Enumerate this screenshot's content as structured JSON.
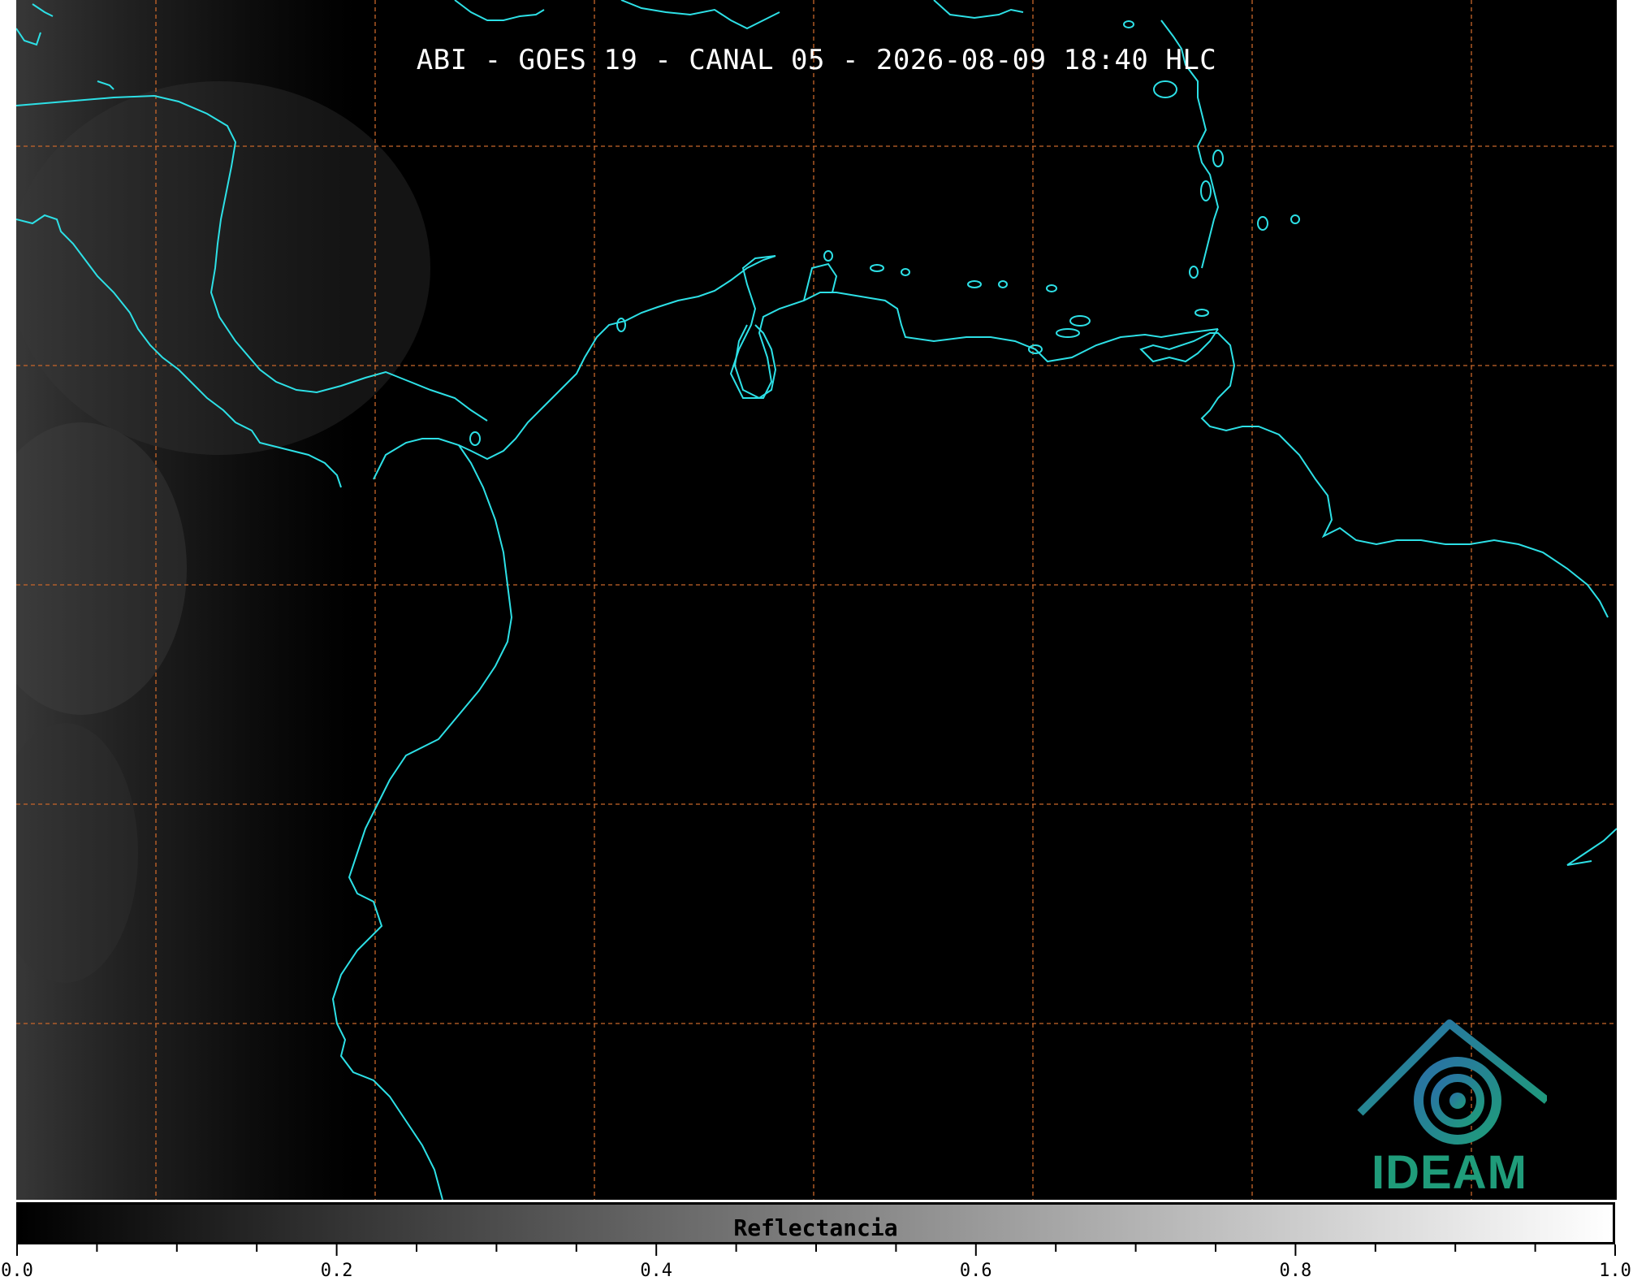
{
  "title": "ABI - GOES 19 - CANAL 05 - 2026-08-09 18:40 HLC",
  "colorbar": {
    "label": "Reflectancia",
    "ticks": [
      "0.0",
      "0.2",
      "0.4",
      "0.6",
      "0.8",
      "1.0"
    ],
    "range": [
      0.0,
      1.0
    ],
    "minor_step": 0.05
  },
  "logo": {
    "text": "IDEAM",
    "colors": [
      "#1f9c7a",
      "#2a6fa8"
    ]
  },
  "colors": {
    "coastline": "#2de0e6",
    "gridline": "#c8662a",
    "background": "#000000"
  }
}
